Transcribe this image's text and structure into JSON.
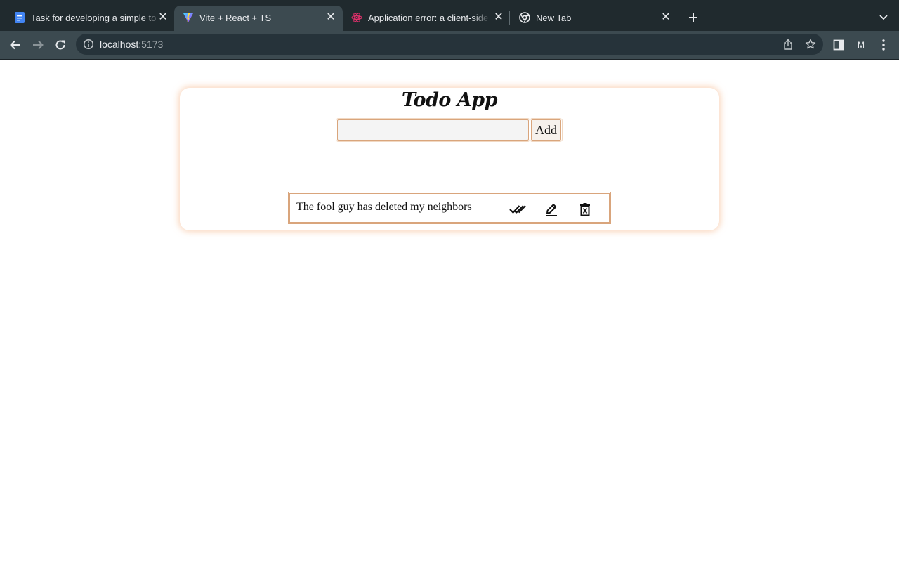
{
  "browser": {
    "tabs": [
      {
        "title": "Task for developing a simple to",
        "favicon": "google-docs-icon",
        "active": false
      },
      {
        "title": "Vite + React + TS",
        "favicon": "vite-icon",
        "active": true
      },
      {
        "title": "Application error: a client-side",
        "favicon": "react-icon",
        "active": false
      },
      {
        "title": "New Tab",
        "favicon": "chrome-icon",
        "active": false
      }
    ],
    "url_host": "localhost",
    "url_port": ":5173",
    "profile_initial": "M"
  },
  "app": {
    "title": "Todo App",
    "input": {
      "value": "",
      "placeholder": ""
    },
    "add_label": "Add",
    "todos": [
      {
        "text": "The fool guy has deleted my neighbors",
        "actions": [
          "double-check-icon",
          "pencil-icon",
          "trash-icon"
        ]
      }
    ]
  },
  "colors": {
    "tabstrip_bg": "#202a2e",
    "toolbar_bg": "#3c4a50",
    "accent_border": "#d9a57c",
    "card_glow": "#f5b487"
  }
}
